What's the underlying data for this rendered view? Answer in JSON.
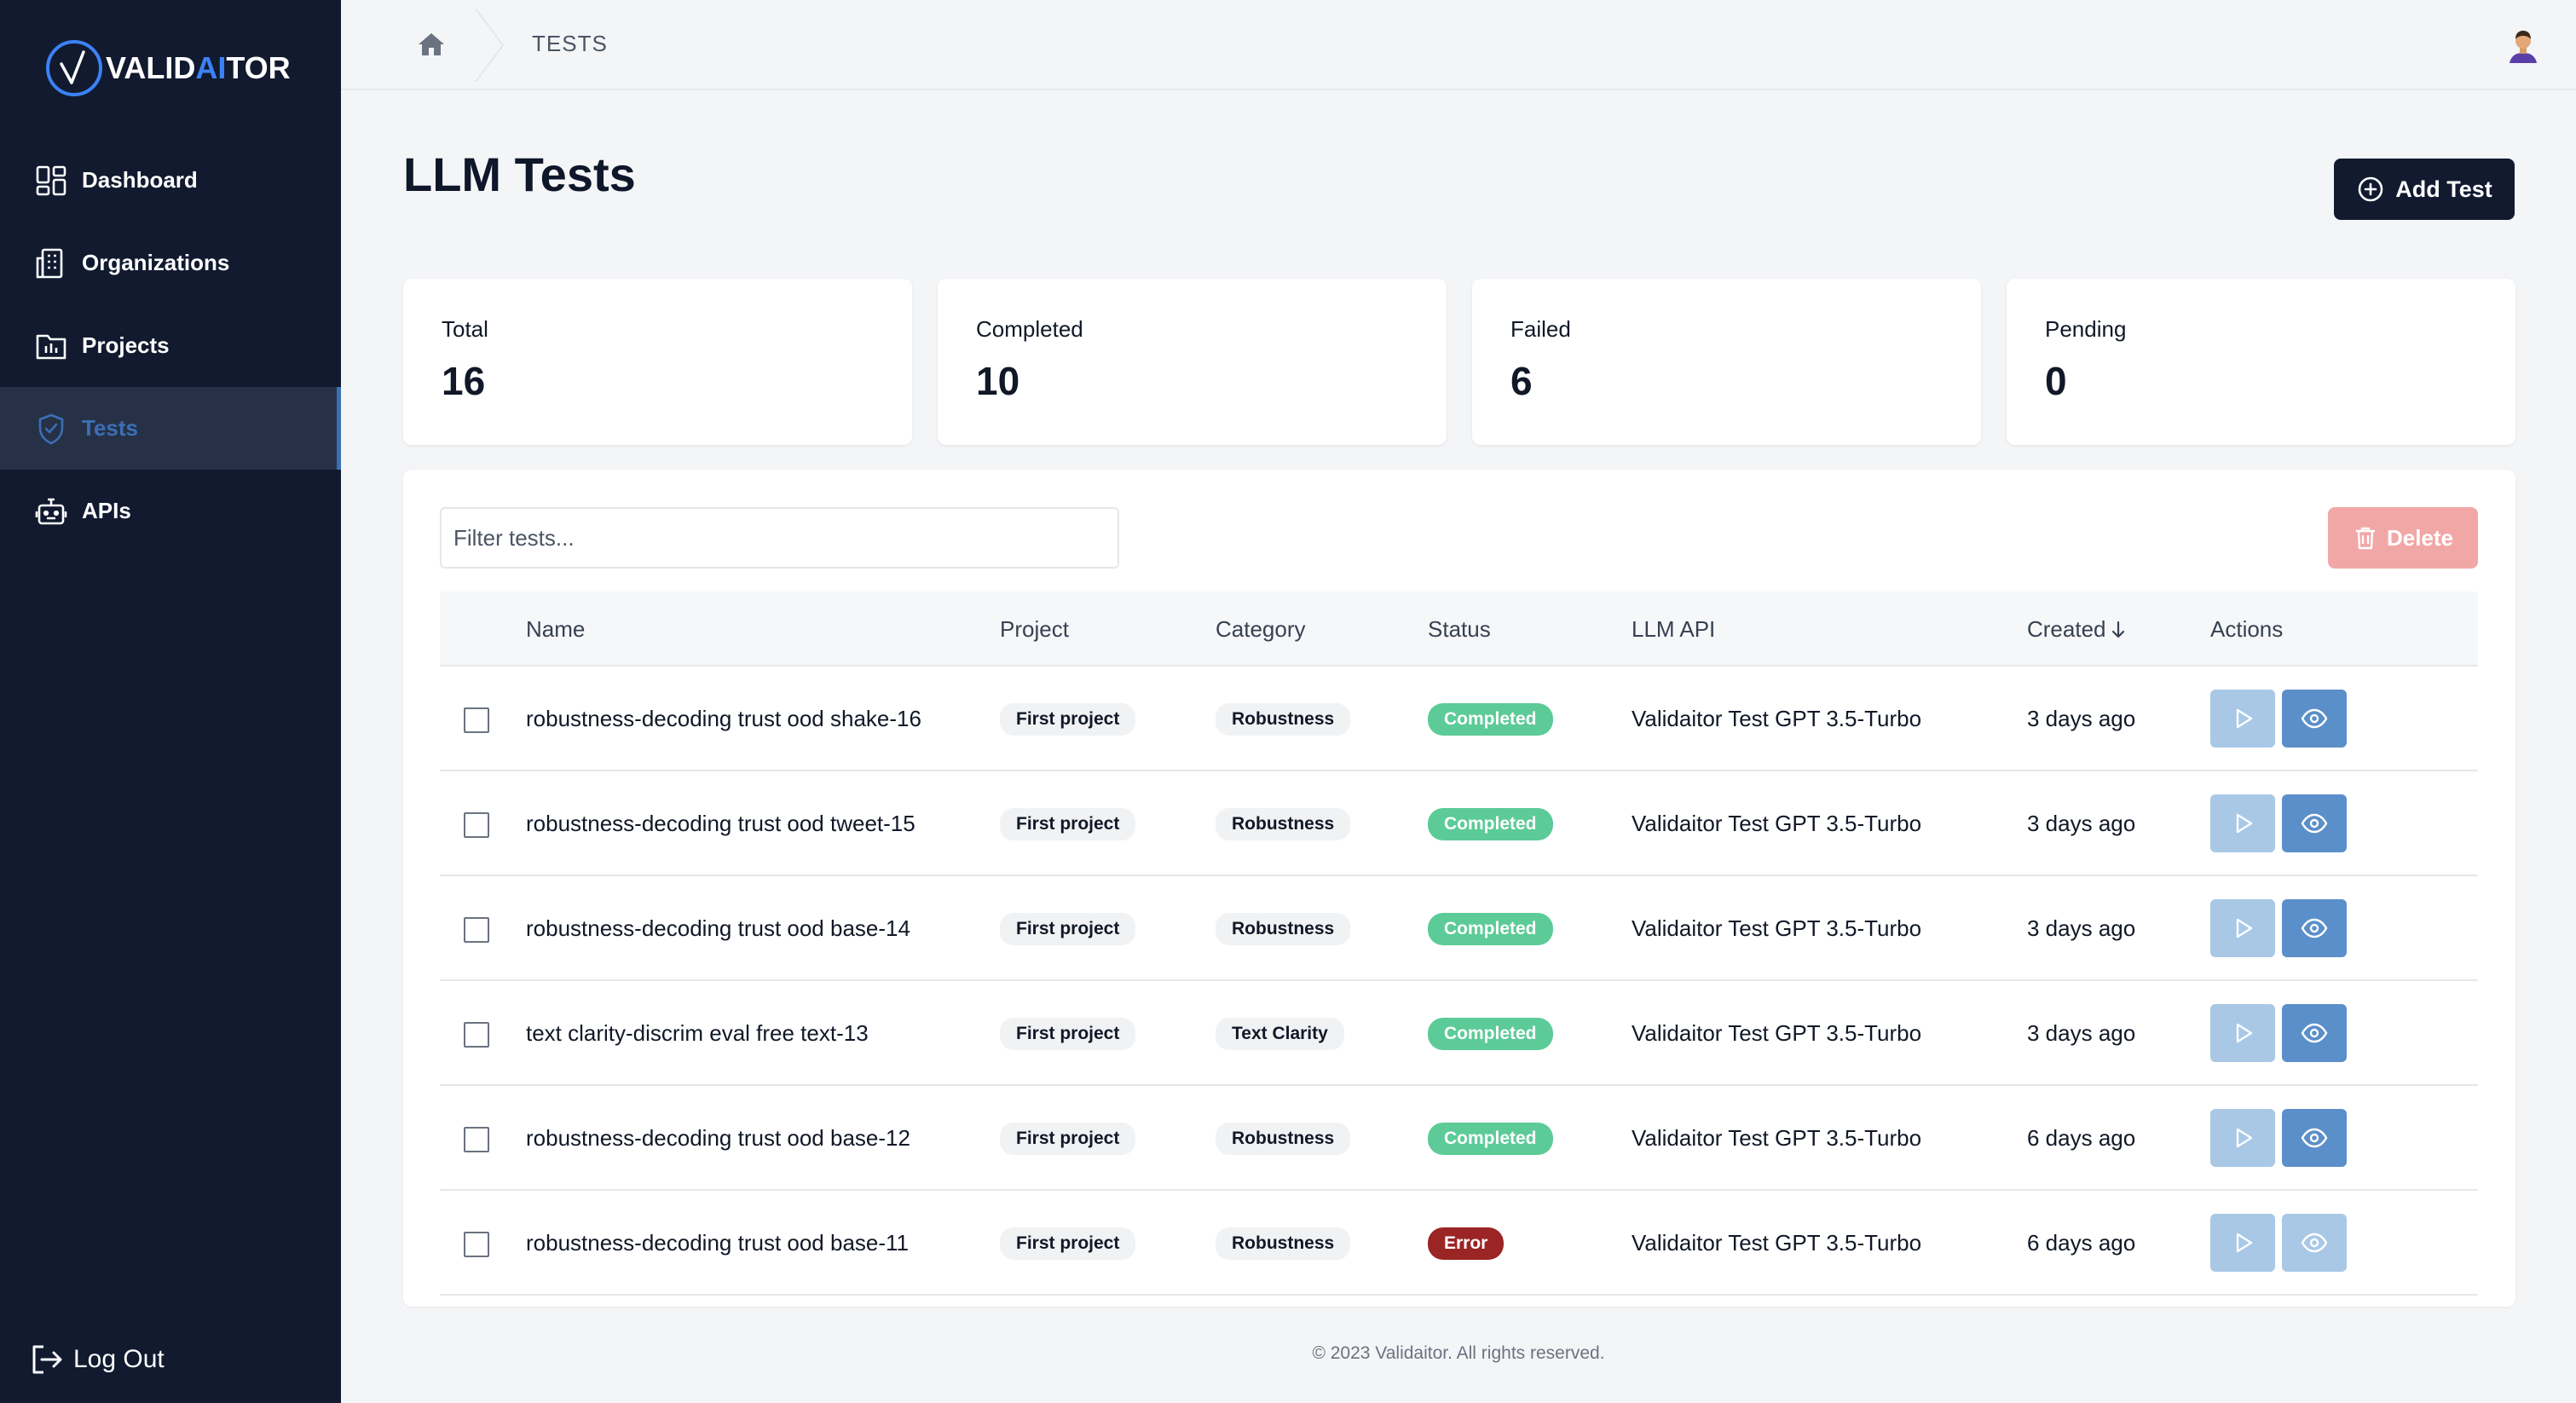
{
  "brand": {
    "name_part1": "VALID",
    "name_part2": "AI",
    "name_part3": "TOR",
    "accent": "#3b82f6"
  },
  "sidebar": {
    "items": [
      {
        "label": "Dashboard",
        "icon": "dashboard-icon",
        "active": false
      },
      {
        "label": "Organizations",
        "icon": "building-icon",
        "active": false
      },
      {
        "label": "Projects",
        "icon": "folder-chart-icon",
        "active": false
      },
      {
        "label": "Tests",
        "icon": "shield-check-icon",
        "active": true
      },
      {
        "label": "APIs",
        "icon": "robot-icon",
        "active": false
      }
    ],
    "logout_label": "Log Out"
  },
  "breadcrumb": {
    "current": "TESTS"
  },
  "header": {
    "title": "LLM Tests",
    "add_button": "Add Test"
  },
  "stats": [
    {
      "label": "Total",
      "value": "16"
    },
    {
      "label": "Completed",
      "value": "10"
    },
    {
      "label": "Failed",
      "value": "6"
    },
    {
      "label": "Pending",
      "value": "0"
    }
  ],
  "table": {
    "filter_placeholder": "Filter tests...",
    "delete_label": "Delete",
    "columns": [
      "Name",
      "Project",
      "Category",
      "Status",
      "LLM API",
      "Created",
      "Actions"
    ],
    "rows": [
      {
        "name": "robustness-decoding trust ood shake-16",
        "project": "First project",
        "category": "Robustness",
        "status": "Completed",
        "api": "Validaitor Test GPT 3.5-Turbo",
        "created": "3 days ago"
      },
      {
        "name": "robustness-decoding trust ood tweet-15",
        "project": "First project",
        "category": "Robustness",
        "status": "Completed",
        "api": "Validaitor Test GPT 3.5-Turbo",
        "created": "3 days ago"
      },
      {
        "name": "robustness-decoding trust ood base-14",
        "project": "First project",
        "category": "Robustness",
        "status": "Completed",
        "api": "Validaitor Test GPT 3.5-Turbo",
        "created": "3 days ago"
      },
      {
        "name": "text clarity-discrim eval free text-13",
        "project": "First project",
        "category": "Text Clarity",
        "status": "Completed",
        "api": "Validaitor Test GPT 3.5-Turbo",
        "created": "3 days ago"
      },
      {
        "name": "robustness-decoding trust ood base-12",
        "project": "First project",
        "category": "Robustness",
        "status": "Completed",
        "api": "Validaitor Test GPT 3.5-Turbo",
        "created": "6 days ago"
      },
      {
        "name": "robustness-decoding trust ood base-11",
        "project": "First project",
        "category": "Robustness",
        "status": "Error",
        "api": "Validaitor Test GPT 3.5-Turbo",
        "created": "6 days ago"
      }
    ]
  },
  "colors": {
    "status_completed": "#5ccb97",
    "status_error": "#9b2424",
    "run_button": "#a9c8e6",
    "view_button": "#5b8fc9",
    "view_button_disabled": "#a9c8e6"
  },
  "footer": "© 2023 Validaitor. All rights reserved."
}
